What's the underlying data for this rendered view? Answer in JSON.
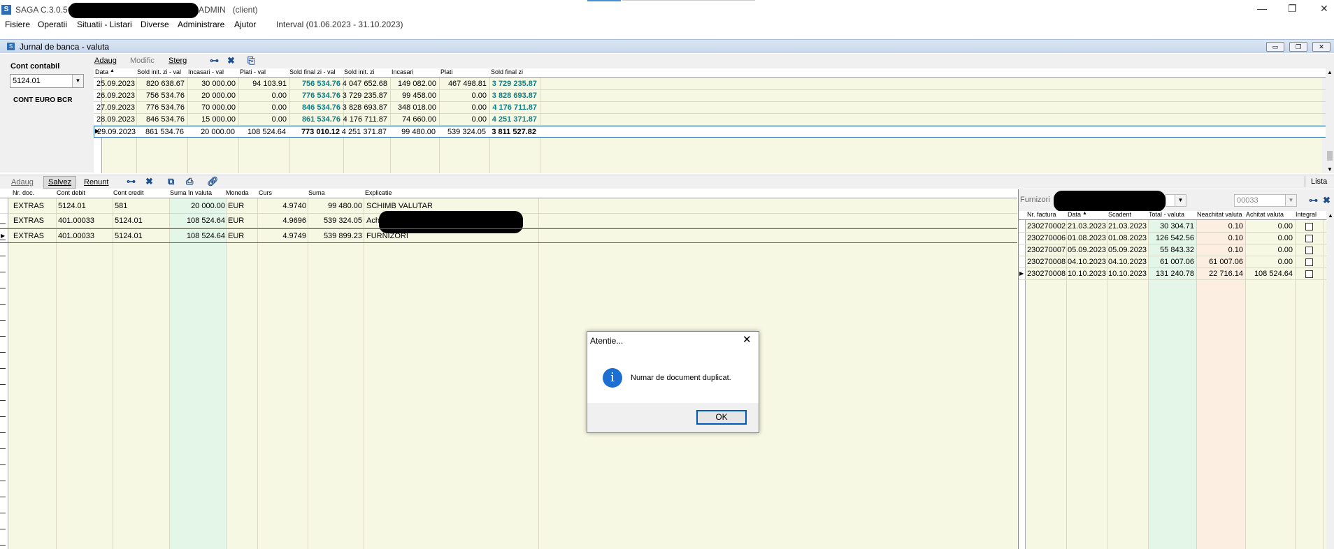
{
  "window": {
    "app_title_prefix": "SAGA C.3.0.56",
    "app_title_suffix": "ADMIN   (client)",
    "icon_letter": "S"
  },
  "menu": [
    "Fisiere",
    "Operatii",
    "Situatii - Listari",
    "Diverse",
    "Administrare",
    "Ajutor"
  ],
  "interval": "Interval (01.06.2023 - 31.10.2023)",
  "child": {
    "title": "Jurnal de banca - valuta"
  },
  "left": {
    "cont_label": "Cont contabil",
    "cont_value": "5124.01",
    "cont_name": "CONT EURO BCR"
  },
  "top_toolbar": {
    "add": "Adaug",
    "modify": "Modific",
    "delete": "Sterg"
  },
  "top_grid": {
    "headers": [
      "Data",
      "Sold init. zi - val",
      "Incasari - val",
      "Plati - val",
      "Sold final zi - val",
      "Sold init. zi",
      "Incasari",
      "Plati",
      "Sold final zi"
    ],
    "rows": [
      [
        "25.09.2023",
        "820 638.67",
        "30 000.00",
        "94 103.91",
        "756 534.76",
        "4 047 652.68",
        "149 082.00",
        "467 498.81",
        "3 729 235.87"
      ],
      [
        "26.09.2023",
        "756 534.76",
        "20 000.00",
        "0.00",
        "776 534.76",
        "3 729 235.87",
        "99 458.00",
        "0.00",
        "3 828 693.87"
      ],
      [
        "27.09.2023",
        "776 534.76",
        "70 000.00",
        "0.00",
        "846 534.76",
        "3 828 693.87",
        "348 018.00",
        "0.00",
        "4 176 711.87"
      ],
      [
        "28.09.2023",
        "846 534.76",
        "15 000.00",
        "0.00",
        "861 534.76",
        "4 176 711.87",
        "74 660.00",
        "0.00",
        "4 251 371.87"
      ],
      [
        "29.09.2023",
        "861 534.76",
        "20 000.00",
        "108 524.64",
        "773 010.12",
        "4 251 371.87",
        "99 480.00",
        "539 324.05",
        "3 811 527.82"
      ]
    ]
  },
  "bottom_toolbar": {
    "add": "Adaug",
    "save": "Salvez",
    "cancel": "Renunt",
    "list": "Lista"
  },
  "bottom_grid": {
    "headers": [
      "Nr. doc.",
      "Cont debit",
      "Cont credit",
      "Suma în valuta",
      "Moneda",
      "Curs",
      "Suma",
      "Explicatie"
    ],
    "rows": [
      [
        "EXTRAS",
        "5124.01",
        "581",
        "20 000.00",
        "EUR",
        "4.9740",
        "99 480.00",
        "SCHIMB VALUTAR"
      ],
      [
        "EXTRAS",
        "401.00033",
        "5124.01",
        "108 524.64",
        "EUR",
        "4.9696",
        "539 324.05",
        "Ach"
      ],
      [
        "EXTRAS",
        "401.00033",
        "5124.01",
        "108 524.64",
        "EUR",
        "4.9749",
        "539 899.23",
        "FURNIZORI"
      ]
    ]
  },
  "supplier": {
    "label": "Furnizori",
    "code": "00033",
    "headers": [
      "Nr. factura",
      "Data",
      "Scadent",
      "Total - valuta",
      "Neachitat valuta",
      "Achitat valuta",
      "Integral"
    ],
    "rows": [
      [
        "230270002",
        "21.03.2023",
        "21.03.2023",
        "30 304.71",
        "0.10",
        "0.00"
      ],
      [
        "230270006",
        "01.08.2023",
        "01.08.2023",
        "126 542.56",
        "0.10",
        "0.00"
      ],
      [
        "230270007",
        "05.09.2023",
        "05.09.2023",
        "55 843.32",
        "0.10",
        "0.00"
      ],
      [
        "230270008",
        "04.10.2023",
        "04.10.2023",
        "61 007.06",
        "61 007.06",
        "0.00"
      ],
      [
        "230270008",
        "10.10.2023",
        "10.10.2023",
        "131 240.78",
        "22 716.14",
        "108 524.64"
      ]
    ]
  },
  "dialog": {
    "title": "Atentie...",
    "message": "Numar de document duplicat.",
    "ok": "OK"
  },
  "colors": {
    "grid_bg": "#f7f8e4",
    "teal": "#0e7f86",
    "mint_col": "#e3f6e8",
    "peach_col": "#fdeee2"
  }
}
